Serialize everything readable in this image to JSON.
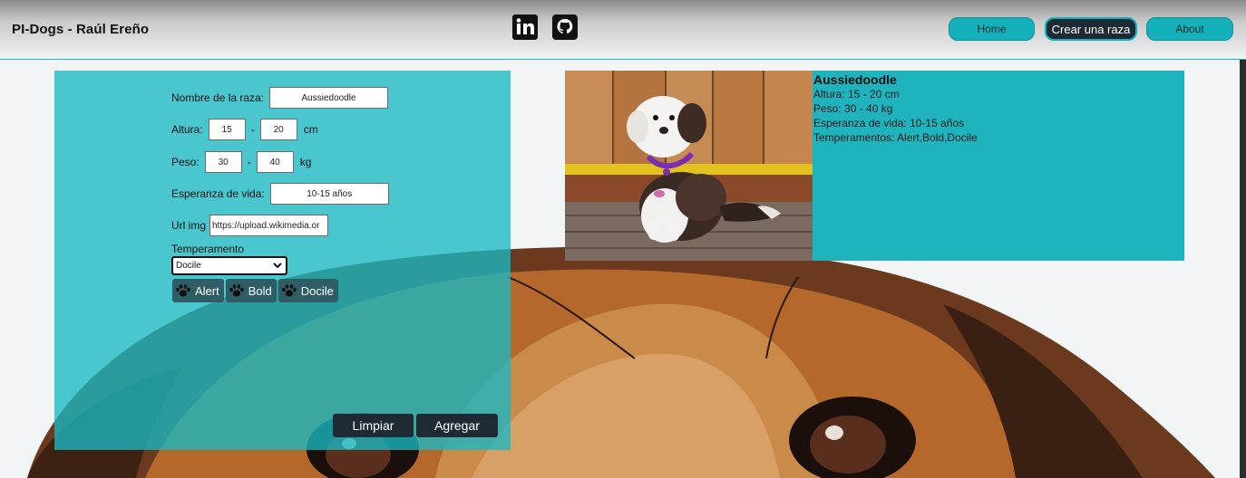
{
  "nav": {
    "brand": "PI-Dogs - Raúl Ereño",
    "home_label": "Home",
    "create_label": "Crear una raza",
    "about_label": "About"
  },
  "form": {
    "name_label": "Nombre de la raza:",
    "name_value": "Aussiedoodle",
    "height_label": "Altura:",
    "height_min": "15",
    "height_max": "20",
    "height_unit": "cm",
    "weight_label": "Peso:",
    "weight_min": "30",
    "weight_max": "40",
    "weight_unit": "kg",
    "life_label": "Esperanza de vida:",
    "life_value": "10-15 años",
    "url_label": "Url img",
    "url_value": "https://upload.wikimedia.or",
    "dash": "-",
    "temperament_label": "Temperamento",
    "temperament_selected": "Docile",
    "temperaments": [
      "Alert",
      "Bold",
      "Docile"
    ],
    "clear_label": "Limpiar",
    "add_label": "Agregar"
  },
  "preview": {
    "name": "Aussiedoodle",
    "height": "Altura: 15 - 20 cm",
    "weight": "Peso: 30 - 40 kg",
    "life": "Esperanza de vida: 10-15 años",
    "temperaments": "Temperamentos: Alert,Bold,Docile"
  },
  "colors": {
    "teal": "#1fb3bd",
    "dark": "#1e2a34",
    "chip": "#2f5d66"
  },
  "icons": {
    "linkedin": "linkedin-icon",
    "github": "github-icon",
    "paw": "paw-icon"
  }
}
